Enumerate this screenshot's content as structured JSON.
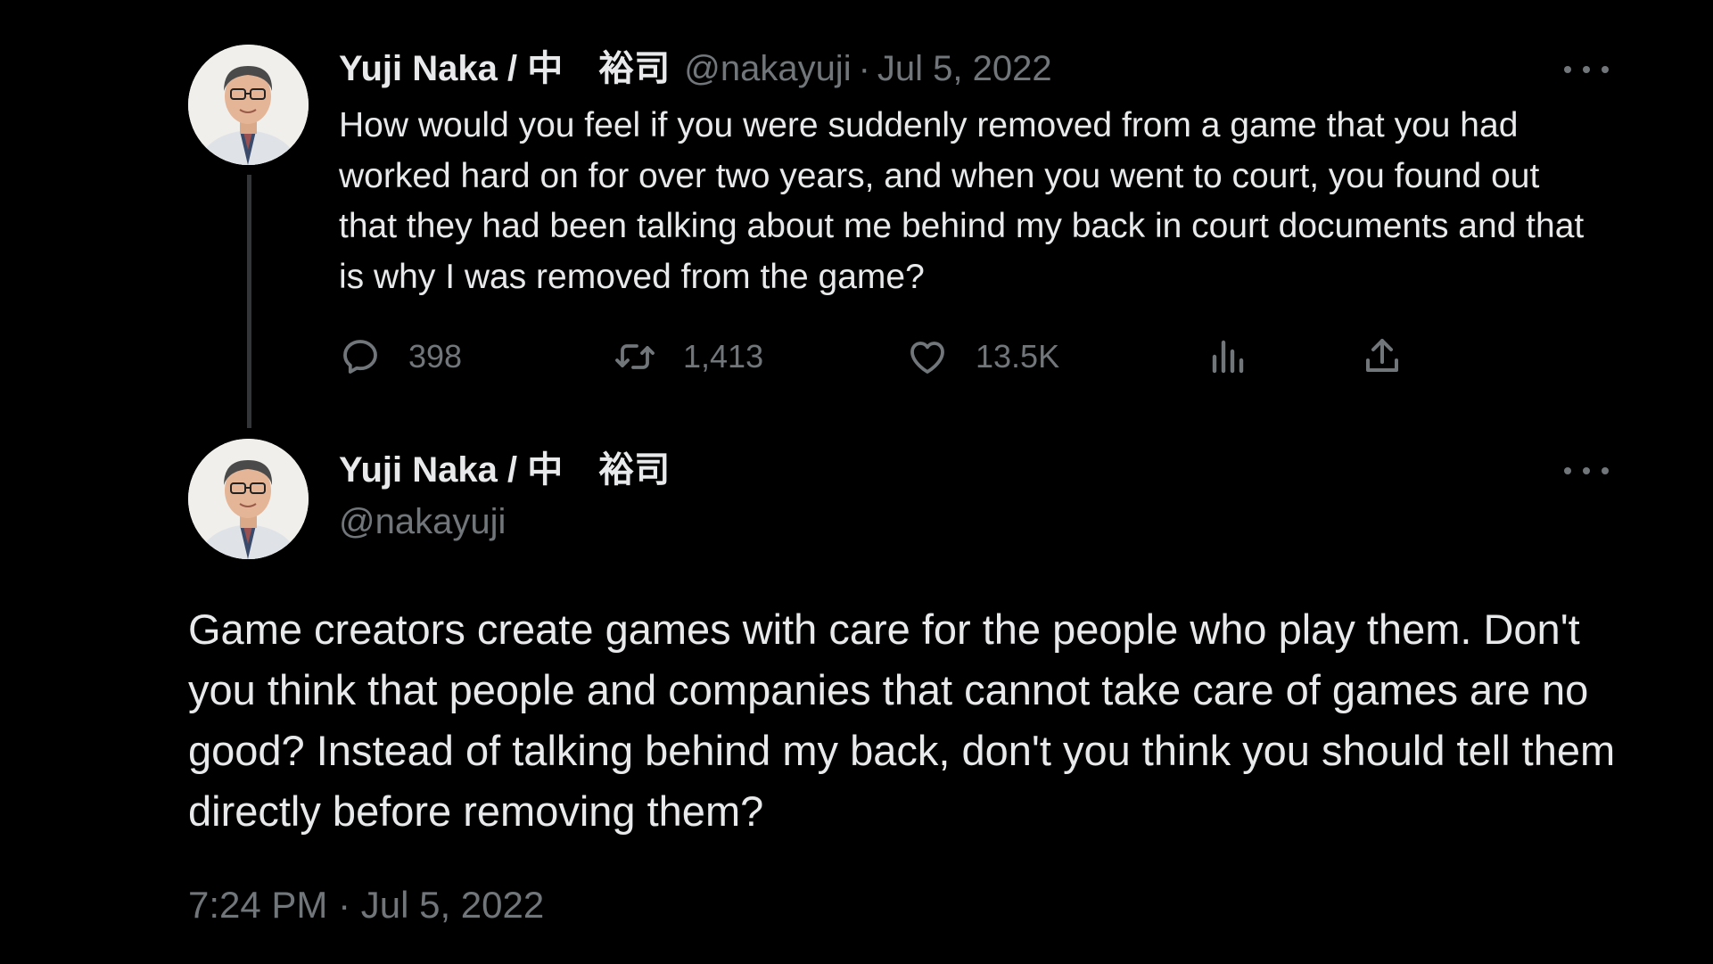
{
  "reply_tweet": {
    "author": {
      "display_name": "Yuji Naka / 中　裕司",
      "handle": "@nakayuji",
      "avatar_icon": "profile-photo"
    },
    "separator": "·",
    "date": "Jul 5, 2022",
    "more_icon": "more-dots-icon",
    "text": "How would you feel if you were suddenly removed from a game that you had worked hard on for over two years, and when you went to court, you found out that they had been talking about me behind my back in court documents and that is why I was removed from the game?",
    "actions": {
      "replies": {
        "icon": "reply-icon",
        "count": "398"
      },
      "retweets": {
        "icon": "retweet-icon",
        "count": "1,413"
      },
      "likes": {
        "icon": "heart-icon",
        "count": "13.5K"
      },
      "views": {
        "icon": "views-chart-icon"
      },
      "share": {
        "icon": "share-icon"
      }
    }
  },
  "main_tweet": {
    "author": {
      "display_name": "Yuji Naka / 中　裕司",
      "handle": "@nakayuji",
      "avatar_icon": "profile-photo"
    },
    "more_icon": "more-dots-icon",
    "text": "Game creators create games with care for the people who play them. Don't you think that people and companies that cannot take care of games are no good? Instead of talking behind my back, don't you think you should tell them directly before removing them?",
    "timestamp": "7:24 PM · Jul 5, 2022"
  },
  "colors": {
    "background": "#000000",
    "primary_text": "#e7e9ea",
    "secondary_text": "#71767b",
    "thread_line": "#333639"
  }
}
